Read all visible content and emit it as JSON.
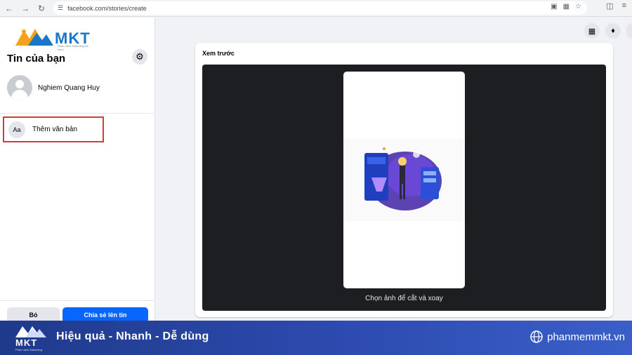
{
  "browser": {
    "url": "facebook.com/stories/create"
  },
  "sidebar": {
    "logo_text": "MKT",
    "logo_tagline": "Phần mềm Marketing đa kênh",
    "title": "Tin của bạn",
    "profile_name": "Nghiem Quang Huy",
    "add_text_icon": "Aa",
    "add_text_label": "Thêm văn bản",
    "discard_label": "Bỏ",
    "share_label": "Chia sẻ lên tin"
  },
  "preview": {
    "title": "Xem trước",
    "crop_label": "Chọn ảnh để cắt và xoay"
  },
  "banner": {
    "logo_text": "MKT",
    "logo_tagline": "Phần mềm Marketing",
    "slogan": "Hiệu quả - Nhanh  - Dễ dùng",
    "website": "phanmemmkt.vn"
  },
  "colors": {
    "accent": "#0866ff",
    "highlight_border": "#d63b3b",
    "stage_bg": "#1c1e21",
    "banner": "#2d4bb0"
  },
  "icons": [
    "back-icon",
    "forward-icon",
    "reload-icon",
    "site-info-icon",
    "screen-cast-icon",
    "translate-icon",
    "star-icon",
    "extensions-icon",
    "reading-list-icon",
    "gear-icon",
    "apps-grid-icon",
    "bell-icon",
    "globe-icon"
  ]
}
